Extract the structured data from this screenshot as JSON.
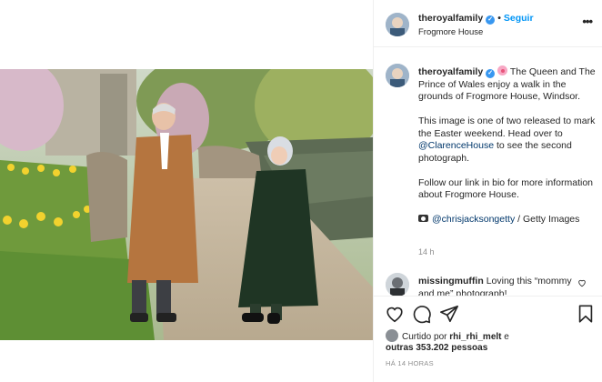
{
  "post": {
    "username": "theroyalfamily",
    "follow_label": "Seguir",
    "location": "Frogmore House",
    "caption_lines": [
      "The Queen and The Prince of Wales enjoy a walk in the grounds of Frogmore House, Windsor.",
      "This image is one of two released to mark the Easter weekend. Head over to",
      "@ClarenceHouse",
      "to see the second photograph.",
      "Follow our link in bio for more information about Frogmore House.",
      "@chrisjacksongetty",
      "/ Getty Images"
    ],
    "caption_time": "14 h"
  },
  "comment": {
    "username": "missingmuffin",
    "text": "Loving this “mommy and me” photograph!"
  },
  "likes": {
    "prefix": "Curtido por",
    "user": "rhi_rhi_melt",
    "conj": "e",
    "others": "outras 353.202 pessoas"
  },
  "timestamp": "HÁ 14 HORAS",
  "icons": {
    "verified": "verified-badge-icon",
    "more": "more-options-icon",
    "like": "heart-icon",
    "comment": "comment-icon",
    "share": "share-icon",
    "save": "bookmark-icon"
  },
  "colors": {
    "follow": "#0095f6",
    "mention": "#00376b",
    "verified": "#3897f0"
  }
}
